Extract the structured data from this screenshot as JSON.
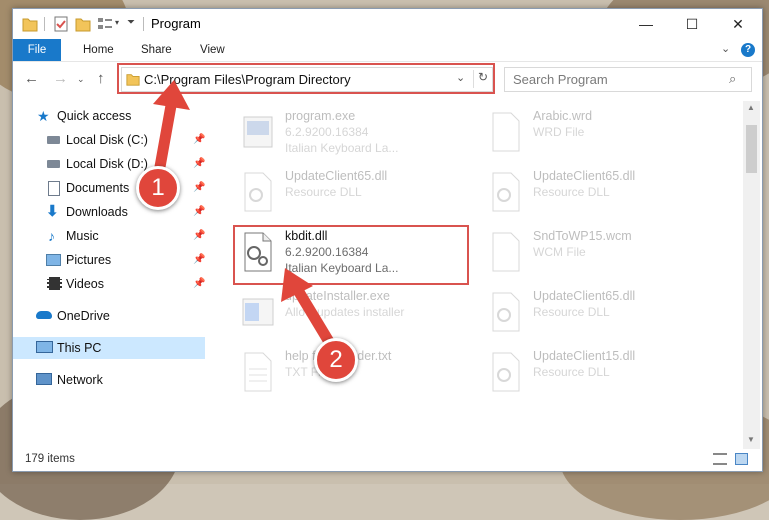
{
  "window": {
    "title": "Program",
    "controls": {
      "minimize": "—",
      "maximize": "☐",
      "close": "✕"
    }
  },
  "ribbon": {
    "tabs": [
      "File",
      "Home",
      "Share",
      "View"
    ],
    "help_icon": "help-icon"
  },
  "navbar": {
    "address": "C:\\Program Files\\Program Directory",
    "search_placeholder": "Search Program"
  },
  "sidebar": {
    "items": [
      {
        "label": "Quick access",
        "icon": "star-icon"
      },
      {
        "label": "Local Disk (C:)",
        "icon": "drive-icon",
        "pinned": true
      },
      {
        "label": "Local Disk (D:)",
        "icon": "drive-icon",
        "pinned": true
      },
      {
        "label": "Documents",
        "icon": "documents-icon",
        "pinned": true
      },
      {
        "label": "Downloads",
        "icon": "downloads-icon",
        "pinned": true
      },
      {
        "label": "Music",
        "icon": "music-icon",
        "pinned": true
      },
      {
        "label": "Pictures",
        "icon": "pictures-icon",
        "pinned": true
      },
      {
        "label": "Videos",
        "icon": "videos-icon",
        "pinned": true
      },
      {
        "label": "OneDrive",
        "icon": "onedrive-icon"
      },
      {
        "label": "This PC",
        "icon": "pc-icon",
        "selected": true
      },
      {
        "label": "Network",
        "icon": "network-icon"
      }
    ]
  },
  "files": [
    {
      "name": "program.exe",
      "line1": "6.2.9200.16384",
      "line2": "Italian Keyboard La...",
      "faded": true
    },
    {
      "name": "Arabic.wrd",
      "line1": "WRD File",
      "line2": "",
      "faded": true
    },
    {
      "name": "UpdateClient65.dll",
      "line1": "Resource DLL",
      "line2": "",
      "faded": true
    },
    {
      "name": "UpdateClient65.dll",
      "line1": "Resource DLL",
      "line2": "",
      "faded": true
    },
    {
      "name": "kbdit.dll",
      "line1": "6.2.9200.16384",
      "line2": "Italian Keyboard La...",
      "faded": false
    },
    {
      "name": "SndToWP15.wcm",
      "line1": "WCM File",
      "line2": "",
      "faded": true
    },
    {
      "name": "updateInstaller.exe",
      "line1": "Allow updates installer",
      "line2": "",
      "faded": true
    },
    {
      "name": "UpdateClient65.dll",
      "line1": "Resource DLL",
      "line2": "",
      "faded": true
    },
    {
      "name": "help foder folder.txt",
      "line1": "TXT File",
      "line2": "",
      "faded": true
    },
    {
      "name": "UpdateClient15.dll",
      "line1": "Resource DLL",
      "line2": "",
      "faded": true
    }
  ],
  "status": {
    "items_count": "179 items"
  },
  "annotations": {
    "badge1": "1",
    "badge2": "2",
    "accent": "#e0463b"
  }
}
